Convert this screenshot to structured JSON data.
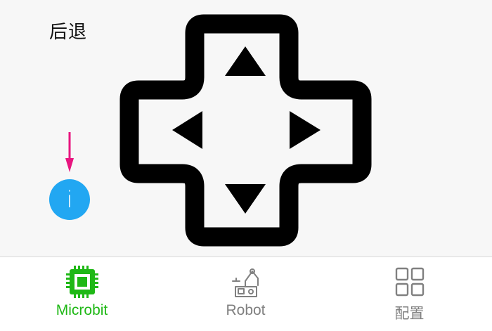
{
  "header": {
    "back_label": "后退"
  },
  "controls": {
    "dpad_icons": [
      "arrow-up-icon",
      "arrow-left-icon",
      "arrow-right-icon",
      "arrow-down-icon"
    ],
    "info_glyph": "i",
    "info_color": "#22a7f2",
    "indicator_color": "#e8157f"
  },
  "tabbar": {
    "active_color": "#1fb816",
    "inactive_color": "#808080",
    "tabs": [
      {
        "label": "Microbit",
        "icon": "chip-icon",
        "active": true
      },
      {
        "label": "Robot",
        "icon": "robot-arm-icon",
        "active": false
      },
      {
        "label": "配置",
        "icon": "grid-icon",
        "active": false
      }
    ]
  }
}
